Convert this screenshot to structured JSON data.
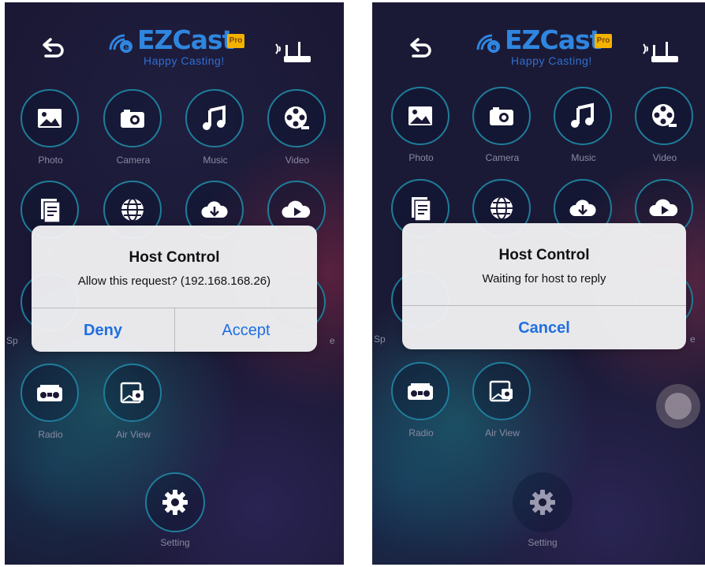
{
  "left": {
    "app": {
      "name": "EZCast",
      "badge": "Pro",
      "tagline": "Happy Casting!"
    },
    "tiles": [
      {
        "label": "Photo",
        "icon": "photo-icon"
      },
      {
        "label": "Camera",
        "icon": "camera-icon"
      },
      {
        "label": "Music",
        "icon": "music-icon"
      },
      {
        "label": "Video",
        "icon": "video-reel-icon"
      },
      {
        "label": "D",
        "icon": "document-icon"
      },
      {
        "label": "",
        "icon": "globe-icon"
      },
      {
        "label": "",
        "icon": "cloud-download-icon"
      },
      {
        "label": "",
        "icon": "cloud-play-icon"
      },
      {
        "label": "Radio",
        "icon": "radio-icon"
      },
      {
        "label": "Air View",
        "icon": "air-view-icon"
      }
    ],
    "edge_labels": {
      "left": "Sp",
      "right": "e"
    },
    "setting": {
      "label": "Setting"
    },
    "dialog": {
      "title": "Host Control",
      "message": "Allow this request? (192.168.168.26)",
      "deny": "Deny",
      "accept": "Accept"
    }
  },
  "right": {
    "app": {
      "name": "EZCast",
      "badge": "Pro",
      "tagline": "Happy Casting!"
    },
    "tiles": [
      {
        "label": "Photo",
        "icon": "photo-icon"
      },
      {
        "label": "Camera",
        "icon": "camera-icon"
      },
      {
        "label": "Music",
        "icon": "music-icon"
      },
      {
        "label": "Video",
        "icon": "video-reel-icon"
      },
      {
        "label": "D",
        "icon": "document-icon"
      },
      {
        "label": "",
        "icon": "globe-icon"
      },
      {
        "label": "",
        "icon": "cloud-download-icon"
      },
      {
        "label": "",
        "icon": "cloud-play-icon"
      },
      {
        "label": "Radio",
        "icon": "radio-icon"
      },
      {
        "label": "Air View",
        "icon": "air-view-icon"
      }
    ],
    "edge_labels": {
      "left": "Sp",
      "right": "e"
    },
    "setting": {
      "label": "Setting"
    },
    "dialog": {
      "title": "Host Control",
      "message": "Waiting for host to reply",
      "cancel": "Cancel"
    }
  },
  "colors": {
    "accent": "#2f86e0",
    "button_text": "#1f6fe0",
    "tile_ring": "#1f7d9a",
    "label_text": "#8a8aa2",
    "pro_badge": "#f3b100",
    "background": "#1a1834"
  }
}
